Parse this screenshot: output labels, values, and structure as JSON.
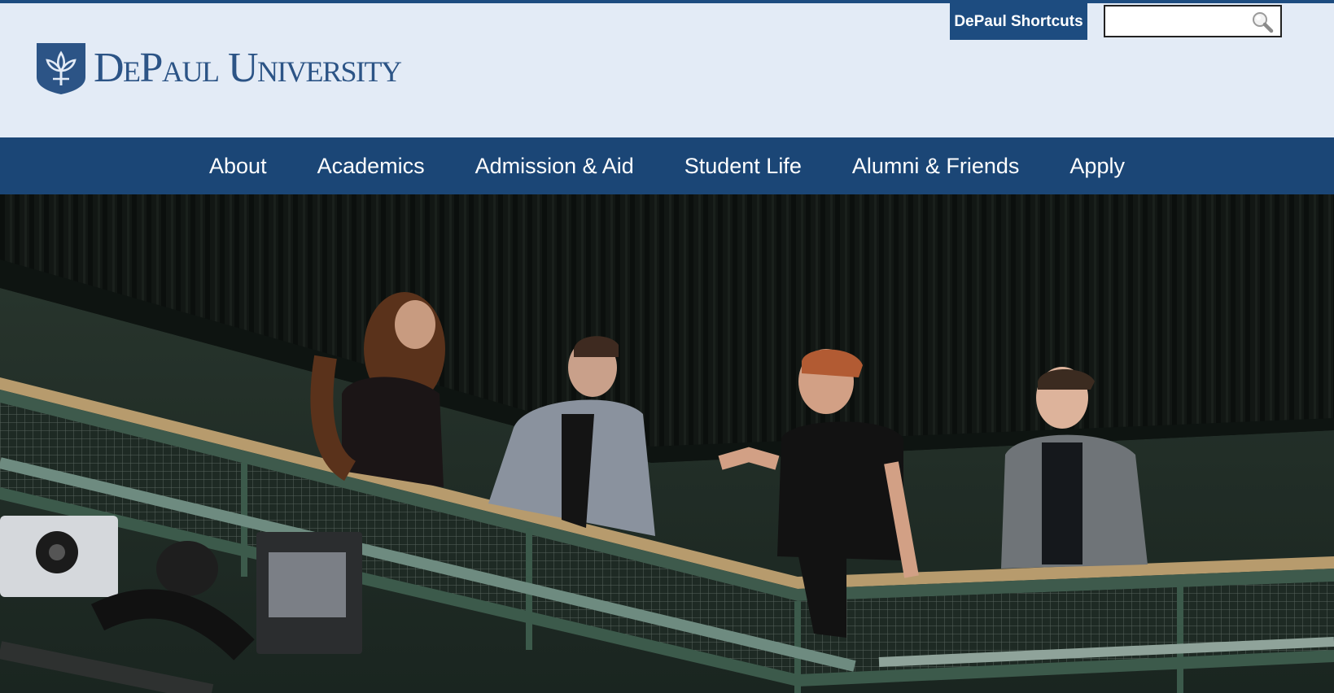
{
  "header": {
    "logo_text": "DePaul University",
    "shortcuts_label": "DePaul Shortcuts",
    "search": {
      "placeholder": "",
      "value": ""
    }
  },
  "nav": {
    "items": [
      {
        "label": "About"
      },
      {
        "label": "Academics"
      },
      {
        "label": "Admission & Aid"
      },
      {
        "label": "Student Life"
      },
      {
        "label": "Alumni & Friends"
      },
      {
        "label": "Apply"
      }
    ]
  },
  "colors": {
    "brand_blue": "#1d4c80",
    "nav_blue": "#1b4676",
    "header_bg": "#e3ebf6",
    "logo_blue": "#2c5486"
  },
  "icons": [
    "depaul-shield-icon",
    "search-icon"
  ]
}
